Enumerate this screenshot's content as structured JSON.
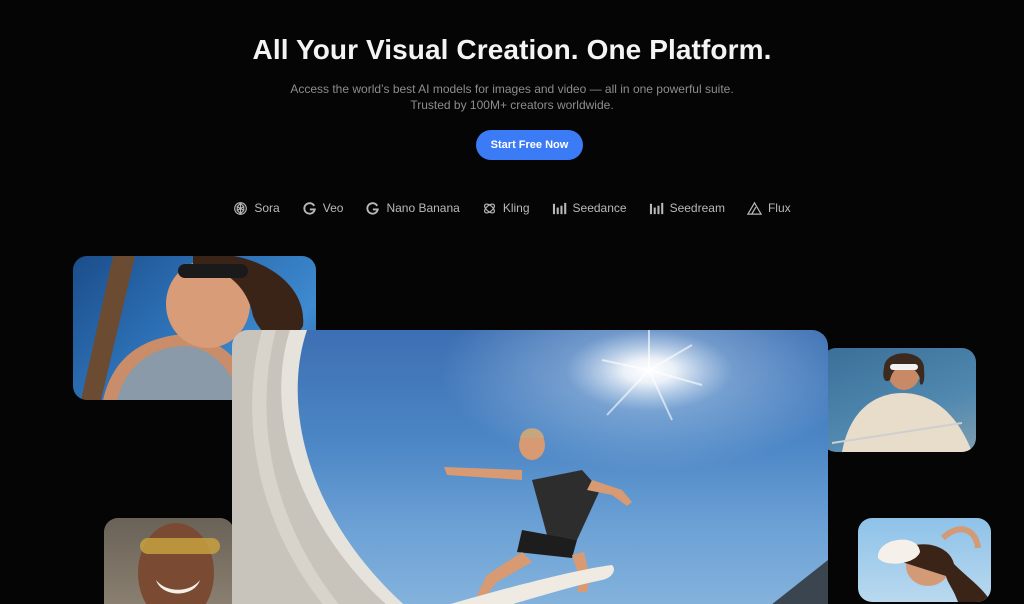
{
  "hero": {
    "title": "All Your Visual Creation. One Platform.",
    "subtitle_line1": "Access the world’s best AI models for images and video — all in one powerful suite.",
    "subtitle_line2": "Trusted by 100M+ creators worldwide.",
    "cta_label": "Start Free Now"
  },
  "models": [
    {
      "label": "Sora",
      "icon": "openai-icon"
    },
    {
      "label": "Veo",
      "icon": "google-g-icon"
    },
    {
      "label": "Nano Banana",
      "icon": "google-g-icon"
    },
    {
      "label": "Kling",
      "icon": "kling-icon"
    },
    {
      "label": "Seedance",
      "icon": "bars-icon"
    },
    {
      "label": "Seedream",
      "icon": "bars-icon"
    },
    {
      "label": "Flux",
      "icon": "triangle-icon"
    }
  ],
  "colors": {
    "background": "#050505",
    "accent": "#3b7cf6",
    "title": "#f4f4f4",
    "subtitle": "#8d8d8d",
    "model_label": "#b9b9b9"
  }
}
